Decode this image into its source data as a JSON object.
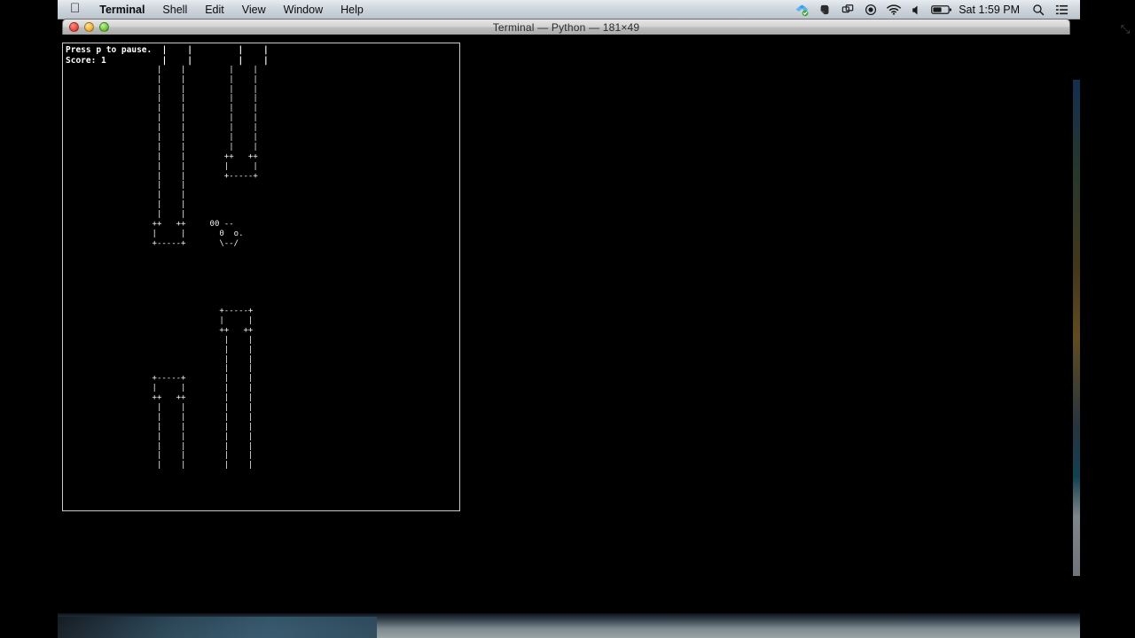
{
  "menubar": {
    "apple_icon": "apple-logo-icon",
    "items": [
      {
        "label": "Terminal",
        "name": "menu-terminal",
        "bold": true
      },
      {
        "label": "Shell",
        "name": "menu-shell",
        "bold": false
      },
      {
        "label": "Edit",
        "name": "menu-edit",
        "bold": false
      },
      {
        "label": "View",
        "name": "menu-view",
        "bold": false
      },
      {
        "label": "Window",
        "name": "menu-window",
        "bold": false
      },
      {
        "label": "Help",
        "name": "menu-help",
        "bold": false
      }
    ],
    "status_icons": [
      {
        "name": "dropbox-sync-icon",
        "glyph": "❖"
      },
      {
        "name": "evernote-icon",
        "glyph": "◔"
      },
      {
        "name": "screen-mirroring-icon",
        "glyph": "⧉"
      },
      {
        "name": "record-icon",
        "glyph": "◉"
      },
      {
        "name": "wifi-icon",
        "glyph": "◠"
      },
      {
        "name": "volume-icon",
        "glyph": "◀"
      },
      {
        "name": "battery-icon",
        "glyph": "▭"
      }
    ],
    "clock": "Sat 1:59 PM",
    "search_icon": "search-icon",
    "notification_center_icon": "notification-center-icon"
  },
  "window": {
    "title": "Terminal — Python — 181×49",
    "close_button_label": "Close",
    "minimize_button_label": "Minimize",
    "zoom_button_label": "Zoom",
    "resize_handle_glyph": "⤡"
  },
  "terminal": {
    "columns": 181,
    "rows": 49,
    "background_color": "#000000",
    "foreground_color": "#f2f2f2",
    "hud": {
      "pause_hint": "Press p to pause.",
      "score_label": "Score: 1",
      "score_value": 1
    },
    "game": {
      "name": "ascii-flappy-bird",
      "bird_sprite": [
        "00 --",
        " 0  o.",
        " \\--/"
      ],
      "pipe_chars": {
        "wall": "|",
        "lip": "+",
        "cap": "++",
        "bar": "-"
      },
      "rows": [
        "Press p to pause.  |    |         |    |",
        "Score: 1           |    |         |    |",
        "                   |    |         |    |",
        "                   |    |         |    |",
        "                   |    |         |    |",
        "                   |    |         |    |",
        "                   |    |         |    |",
        "                   |    |         |    |",
        "                   |    |         |    |",
        "                   |    |         |    |",
        "                   |    |         |    |",
        "                   |    |        ++   ++",
        "                   |    |        |     |",
        "                   |    |        +-----+",
        "                   |    |",
        "                   |    |",
        "                   |    |",
        "                   |    |",
        "                  ++   ++     00 --",
        "                  |     |       0  o.",
        "                  +-----+       \\--/",
        "",
        "",
        "",
        "",
        "",
        "",
        "                                +-----+",
        "                                |     |",
        "                                ++   ++",
        "                                 |    |",
        "                                 |    |",
        "                                 |    |",
        "                                 |    |",
        "                  +-----+        |    |",
        "                  |     |        |    |",
        "                  ++   ++        |    |",
        "                   |    |        |    |",
        "                   |    |        |    |",
        "                   |    |        |    |",
        "                   |    |        |    |",
        "                   |    |        |    |",
        "                   |    |        |    |",
        "                   |    |        |    |"
      ]
    }
  }
}
